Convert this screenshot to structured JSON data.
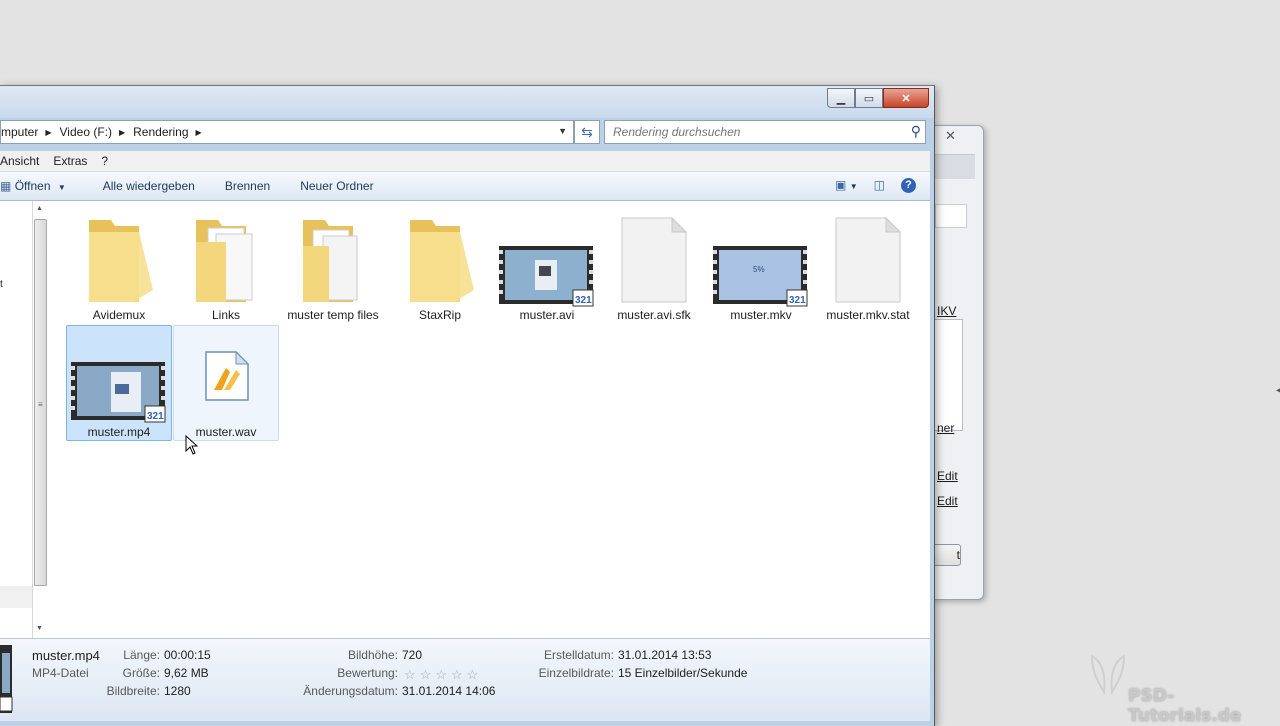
{
  "address": {
    "crumbs": [
      "mputer",
      "Video (F:)",
      "Rendering"
    ]
  },
  "search": {
    "placeholder": "Rendering durchsuchen"
  },
  "menu": {
    "items": [
      "Ansicht",
      "Extras",
      "?"
    ]
  },
  "toolbar": {
    "open": "Öffnen",
    "play_all": "Alle wiedergeben",
    "burn": "Brennen",
    "new_folder": "Neuer Ordner"
  },
  "files": [
    {
      "name": "Avidemux",
      "type": "folder"
    },
    {
      "name": "Links",
      "type": "folder"
    },
    {
      "name": "muster temp files",
      "type": "folder"
    },
    {
      "name": "StaxRip",
      "type": "folder"
    },
    {
      "name": "muster.avi",
      "type": "video"
    },
    {
      "name": "muster.avi.sfk",
      "type": "file"
    },
    {
      "name": "muster.mkv",
      "type": "video"
    },
    {
      "name": "muster.mkv.stat",
      "type": "file"
    },
    {
      "name": "muster.mp4",
      "type": "video",
      "selected": true
    },
    {
      "name": "muster.wav",
      "type": "audio"
    }
  ],
  "details": {
    "filename": "muster.mp4",
    "filetype": "MP4-Datei",
    "length_label": "Länge:",
    "length": "00:00:15",
    "size_label": "Größe:",
    "size": "9,62 MB",
    "width_label": "Bildbreite:",
    "width": "1280",
    "height_label": "Bildhöhe:",
    "height": "720",
    "rating_label": "Bewertung:",
    "rating": 0,
    "modified_label": "Änderungsdatum:",
    "modified": "31.01.2014 14:06",
    "created_label": "Erstelldatum:",
    "created": "31.01.2014 13:53",
    "framerate_label": "Einzelbildrate:",
    "framerate": "15 Einzelbilder/Sekunde"
  },
  "background_window": {
    "link1": "IKV",
    "link2": "ner",
    "edit1": "Edit",
    "edit2": "Edit",
    "button": "t"
  },
  "watermark": "PSD-Tutorials.de"
}
